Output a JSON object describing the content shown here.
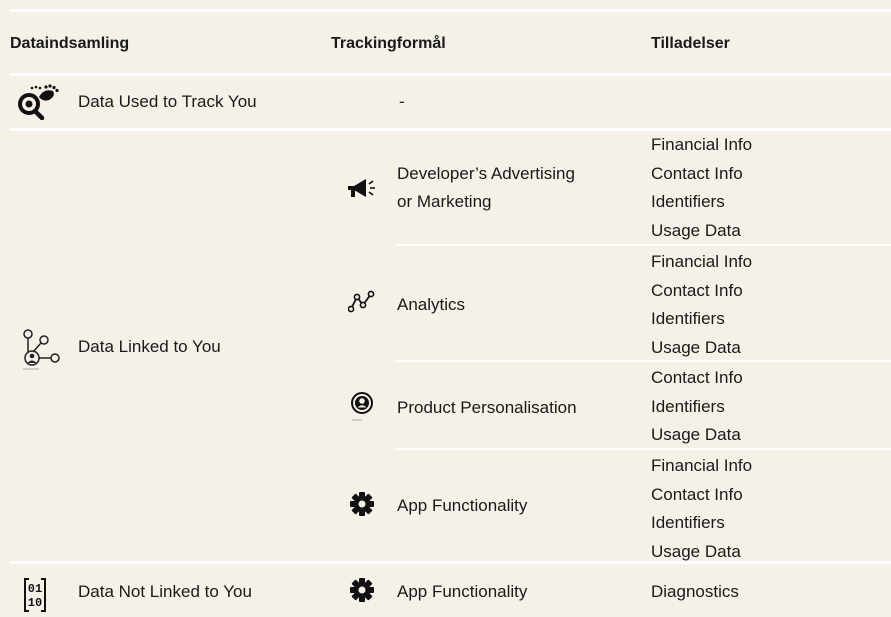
{
  "headers": {
    "col1": "Dataindsamling",
    "col2": "Trackingformål",
    "col3": "Tilladelser"
  },
  "rows": {
    "track": {
      "label": "Data Used to Track You",
      "icon": "footprints-magnifier-icon",
      "purpose": "-"
    },
    "linked": {
      "label": "Data Linked to You",
      "icon": "user-network-icon",
      "purposes": [
        {
          "label_line1": "Developer’s Advertising",
          "label_line2": "or Marketing",
          "icon": "megaphone-icon",
          "permissions": [
            "Financial Info",
            "Contact Info",
            "Identifiers",
            "Usage Data"
          ]
        },
        {
          "label": "Analytics",
          "icon": "analytics-line-icon",
          "permissions": [
            "Financial Info",
            "Contact Info",
            "Identifiers",
            "Usage Data"
          ]
        },
        {
          "label": "Product Personalisation",
          "icon": "user-circle-icon",
          "permissions": [
            "Contact Info",
            "Identifiers",
            "Usage Data"
          ]
        },
        {
          "label": "App Functionality",
          "icon": "gear-icon",
          "permissions": [
            "Financial Info",
            "Contact Info",
            "Identifiers",
            "Usage Data"
          ]
        }
      ]
    },
    "notlinked": {
      "label": "Data Not Linked to You",
      "icon": "binary-data-icon",
      "purpose": {
        "label": "App Functionality",
        "icon": "gear-icon",
        "permission": "Diagnostics"
      }
    }
  }
}
